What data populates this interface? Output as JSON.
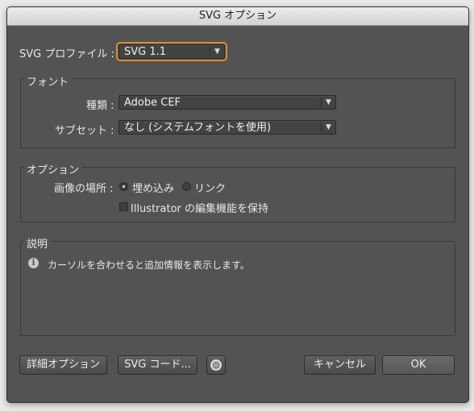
{
  "window": {
    "title": "SVG オプション"
  },
  "profile": {
    "label": "SVG プロファイル :",
    "value": "SVG 1.1"
  },
  "font_group": {
    "title": "フォント",
    "type_label": "種類 :",
    "type_value": "Adobe CEF",
    "subset_label": "サブセット :",
    "subset_value": "なし (システムフォントを使用)"
  },
  "options_group": {
    "title": "オプション",
    "image_location_label": "画像の場所 :",
    "embed_label": "埋め込み",
    "link_label": "リンク",
    "embed_selected": true,
    "preserve_label": "Illustrator の編集機能を保持",
    "preserve_checked": false
  },
  "description_group": {
    "title": "説明",
    "text": "カーソルを合わせると追加情報を表示します。"
  },
  "buttons": {
    "advanced": "詳細オプション",
    "svg_code": "SVG コード...",
    "cancel": "キャンセル",
    "ok": "OK"
  },
  "colors": {
    "dialog_bg": "#535353",
    "focus_ring": "#e08a2a",
    "title_bg": "#dcdcdc"
  }
}
